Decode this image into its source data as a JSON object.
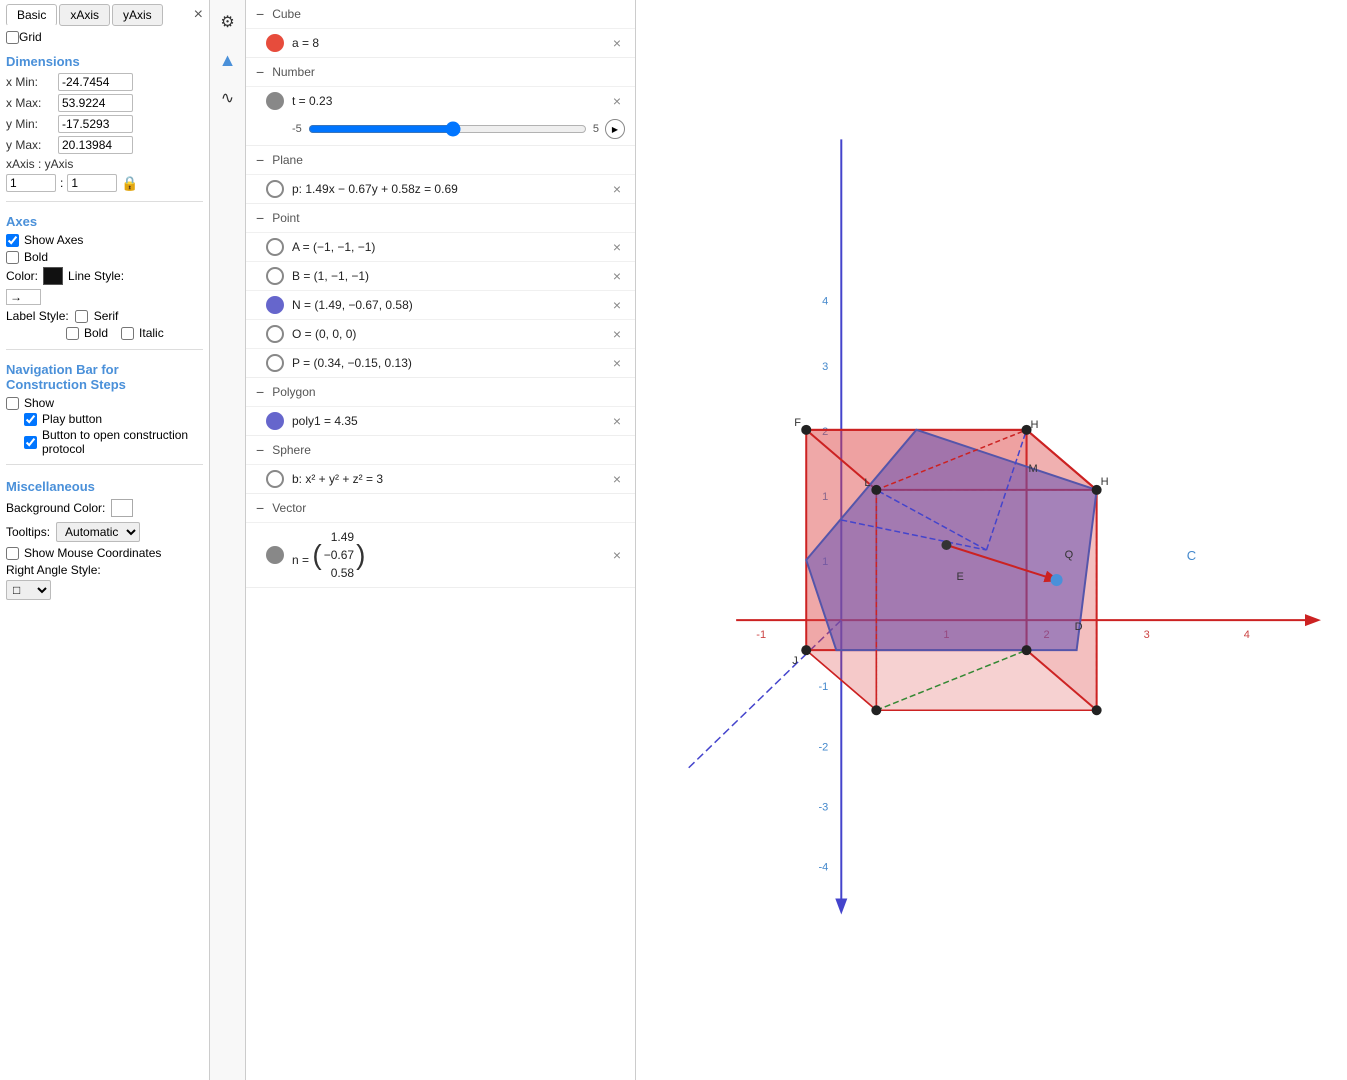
{
  "tabs": {
    "basic": "Basic",
    "xaxis": "xAxis",
    "yaxis": "yAxis"
  },
  "grid": "Grid",
  "close_label": "×",
  "dimensions": {
    "title": "Dimensions",
    "xMin_label": "x Min:",
    "xMin_value": "-24.7454",
    "xMax_label": "x Max:",
    "xMax_value": "53.9224",
    "yMin_label": "y Min:",
    "yMin_value": "-17.5293",
    "yMax_label": "y Max:",
    "yMax_value": "20.13984",
    "ratio_label": "xAxis : yAxis",
    "ratio_x": "1",
    "ratio_y": "1"
  },
  "axes": {
    "title": "Axes",
    "show_axes_label": "Show Axes",
    "bold_label": "Bold",
    "color_label": "Color:",
    "line_style_label": "Line Style:",
    "label_style_label": "Label Style:",
    "serif_label": "Serif",
    "bold2_label": "Bold",
    "italic_label": "Italic"
  },
  "nav_bar": {
    "title": "Navigation Bar for Construction Steps",
    "show_label": "Show",
    "play_label": "Play button",
    "protocol_label": "Button to open construction protocol"
  },
  "misc": {
    "title": "Miscellaneous",
    "bg_color_label": "Background Color:",
    "tooltips_label": "Tooltips:",
    "tooltips_value": "Automatic",
    "show_mouse_label": "Show Mouse Coordinates",
    "right_angle_label": "Right Angle Style:"
  },
  "algebra": {
    "sections": [
      {
        "name": "Cube",
        "items": [
          {
            "dot": "red",
            "text": "a = 8",
            "has_close": true
          }
        ]
      },
      {
        "name": "Number",
        "items": [
          {
            "dot": "gray",
            "text": "t = 0.23",
            "has_close": true,
            "has_slider": true,
            "slider_min": "-5",
            "slider_max": "5",
            "slider_val": 0.56
          }
        ]
      },
      {
        "name": "Plane",
        "items": [
          {
            "dot": "circle",
            "text": "p: 1.49x − 0.67y + 0.58z = 0.69",
            "has_close": true
          }
        ]
      },
      {
        "name": "Point",
        "items": [
          {
            "dot": "circle",
            "text": "A = (−1, −1, −1)",
            "has_close": true
          },
          {
            "dot": "circle",
            "text": "B = (1, −1, −1)",
            "has_close": true
          },
          {
            "dot": "blue_fill",
            "text": "N = (1.49, −0.67, 0.58)",
            "has_close": true
          },
          {
            "dot": "circle",
            "text": "O = (0, 0, 0)",
            "has_close": true
          },
          {
            "dot": "circle",
            "text": "P = (0.34, −0.15, 0.13)",
            "has_close": true
          }
        ]
      },
      {
        "name": "Polygon",
        "items": [
          {
            "dot": "blue_fill",
            "text": "poly1 = 4.35",
            "has_close": true
          }
        ]
      },
      {
        "name": "Sphere",
        "items": [
          {
            "dot": "circle",
            "text": "b: x² + y² + z² = 3",
            "has_close": true
          }
        ]
      },
      {
        "name": "Vector",
        "items": [
          {
            "dot": "gray",
            "text": "vector_n",
            "has_close": true,
            "is_vector": true,
            "vector_vals": [
              "1.49",
              "−0.67",
              "0.58"
            ]
          }
        ]
      }
    ]
  },
  "icons": {
    "gear": "⚙",
    "triangle": "▲",
    "curve": "∿",
    "lock": "🔒",
    "arrow_right": "→",
    "play": "▶"
  }
}
